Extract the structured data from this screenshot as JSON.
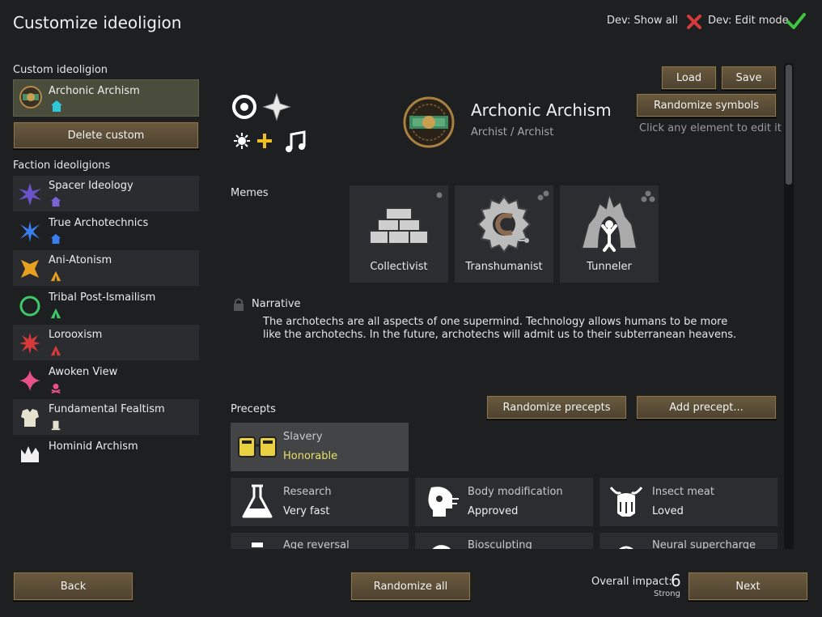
{
  "header": {
    "title": "Customize ideoligion",
    "dev_show_all": "Dev: Show all",
    "dev_edit_mode": "Dev: Edit mode"
  },
  "sidebar": {
    "custom_heading": "Custom ideoligion",
    "custom_item": "Archonic Archism",
    "delete_label": "Delete custom",
    "faction_heading": "Faction ideoligions",
    "factions": [
      {
        "name": "Spacer Ideology"
      },
      {
        "name": "True Archotechnics"
      },
      {
        "name": "Ani-Atonism"
      },
      {
        "name": "Tribal Post-Ismailism"
      },
      {
        "name": "Lorooxism"
      },
      {
        "name": "Awoken View"
      },
      {
        "name": "Fundamental Fealtism"
      },
      {
        "name": "Hominid Archism"
      }
    ]
  },
  "ideo": {
    "name": "Archonic Archism",
    "adjective": "Archist / Archist",
    "load_label": "Load",
    "save_label": "Save",
    "randomize_symbols_label": "Randomize symbols",
    "hint": "Click any element to edit it"
  },
  "memes": {
    "heading": "Memes",
    "items": [
      {
        "label": "Collectivist"
      },
      {
        "label": "Transhumanist"
      },
      {
        "label": "Tunneler"
      }
    ]
  },
  "narrative": {
    "heading": "Narrative",
    "text": "The archotechs are all aspects of one supermind. Technology allows humans to be more like the archotechs. In the future, archotechs will admit us to their subterranean heavens."
  },
  "precepts": {
    "heading": "Precepts",
    "randomize_label": "Randomize precepts",
    "add_label": "Add precept...",
    "items": [
      {
        "name": "Slavery",
        "value": "Honorable"
      },
      {
        "name": "Research",
        "value": "Very fast"
      },
      {
        "name": "Body modification",
        "value": "Approved"
      },
      {
        "name": "Insect meat",
        "value": "Loved"
      },
      {
        "name": "Age reversal",
        "value": ""
      },
      {
        "name": "Biosculpting",
        "value": ""
      },
      {
        "name": "Neural supercharge",
        "value": ""
      }
    ]
  },
  "footer": {
    "back_label": "Back",
    "randomize_all_label": "Randomize all",
    "impact_label": "Overall impact:",
    "impact_value": "6",
    "impact_desc": "Strong",
    "next_label": "Next"
  },
  "colors": {
    "accent_yellow": "#e8e06a",
    "button_brown": "#5e4f36",
    "check_green": "#3ec43e",
    "cross_red": "#d63a3a"
  }
}
